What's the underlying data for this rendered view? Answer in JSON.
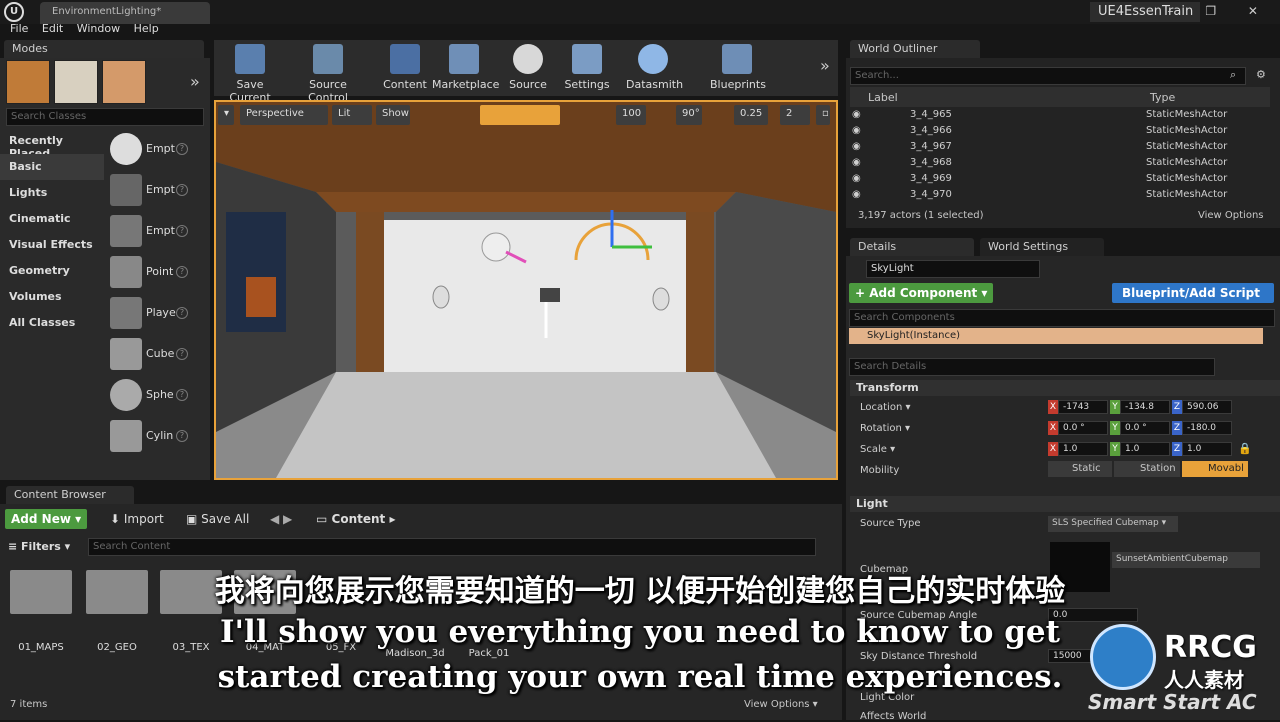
{
  "titlebar": {
    "doc_tab": "EnvironmentLighting*",
    "project": "UE4EssenTrain",
    "window_controls": "– ❐ ✕"
  },
  "menu": [
    "File",
    "Edit",
    "Window",
    "Help"
  ],
  "modes": {
    "tab": "Modes",
    "search_placeholder": "Search Classes",
    "categories": [
      "Recently Placed",
      "Basic",
      "Lights",
      "Cinematic",
      "Visual Effects",
      "Geometry",
      "Volumes",
      "All Classes"
    ],
    "items": [
      "Empt",
      "Empt",
      "Empt",
      "Point",
      "Playe",
      "Cube",
      "Sphe",
      "Cylin"
    ]
  },
  "toolbar": {
    "buttons": [
      "Save Current",
      "Source Control",
      "Content",
      "Marketplace",
      "Source",
      "Settings",
      "Datasmith",
      "Blueprints"
    ]
  },
  "viewport": {
    "perspective": "Perspective",
    "lit": "Lit",
    "show": "Show",
    "grid_size": "100",
    "rot_snap": "90°",
    "scale_snap": "0.25",
    "cam_speed": "2"
  },
  "outliner": {
    "tab": "World Outliner",
    "search_placeholder": "Search...",
    "col_label": "Label",
    "col_type": "Type",
    "rows": [
      {
        "label": "3_4_965",
        "type": "StaticMeshActor"
      },
      {
        "label": "3_4_966",
        "type": "StaticMeshActor"
      },
      {
        "label": "3_4_967",
        "type": "StaticMeshActor"
      },
      {
        "label": "3_4_968",
        "type": "StaticMeshActor"
      },
      {
        "label": "3_4_969",
        "type": "StaticMeshActor"
      },
      {
        "label": "3_4_970",
        "type": "StaticMeshActor"
      }
    ],
    "status": "3,197 actors (1 selected)",
    "view_options": "View Options"
  },
  "details": {
    "tab_details": "Details",
    "tab_world": "World Settings",
    "actor_name": "SkyLight",
    "add_component": "+ Add Component ▾",
    "blueprint_script": "Blueprint/Add Script",
    "search_components": "Search Components",
    "component": "SkyLight(Instance)",
    "search_details": "Search Details",
    "transform_header": "Transform",
    "location_label": "Location ▾",
    "rotation_label": "Rotation ▾",
    "scale_label": "Scale ▾",
    "mobility_label": "Mobility",
    "location": [
      "-1743",
      "-134.8",
      "590.06"
    ],
    "rotation": [
      "0.0 °",
      "0.0 °",
      "-180.0"
    ],
    "scale": [
      "1.0",
      "1.0",
      "1.0"
    ],
    "mobility": [
      "Static",
      "Station",
      "Movabl"
    ],
    "light_header": "Light",
    "source_type_label": "Source Type",
    "source_type": "SLS Specified Cubemap ▾",
    "cubemap_label": "Cubemap",
    "cubemap_value": "SunsetAmbientCubemap",
    "source_angle_label": "Source Cubemap Angle",
    "source_angle": "0.0",
    "sky_threshold_label": "Sky Distance Threshold",
    "sky_threshold": "15000",
    "light_color_label": "Light Color",
    "affects_world_label": "Affects World"
  },
  "content_browser": {
    "tab": "Content Browser",
    "add_new": "Add New ▾",
    "import": "Import",
    "save_all": "Save All",
    "path": "Content",
    "filters": "Filters ▾",
    "search_placeholder": "Search Content",
    "folders": [
      "01_MAPS",
      "02_GEO",
      "03_TEX",
      "04_MAT",
      "05_FX",
      "Madison_3d",
      "Pack_01"
    ],
    "item_count": "7 items",
    "view_options": "View Options ▾"
  },
  "subtitles": {
    "cn": "我将向您展示您需要知道的一切 以便开始创建您自己的实时体验",
    "en_line1": "I'll show you everything you need to know to get",
    "en_line2": "started creating your own real time experiences."
  },
  "watermark": {
    "brand": "RRCG",
    "cn": "人人素材",
    "tagline": "Smart Start AC"
  },
  "colors": {
    "accent_orange": "#e8a23a",
    "green": "#4c9a3f",
    "blue": "#2e76c8",
    "component_bg": "#e3b38a"
  }
}
